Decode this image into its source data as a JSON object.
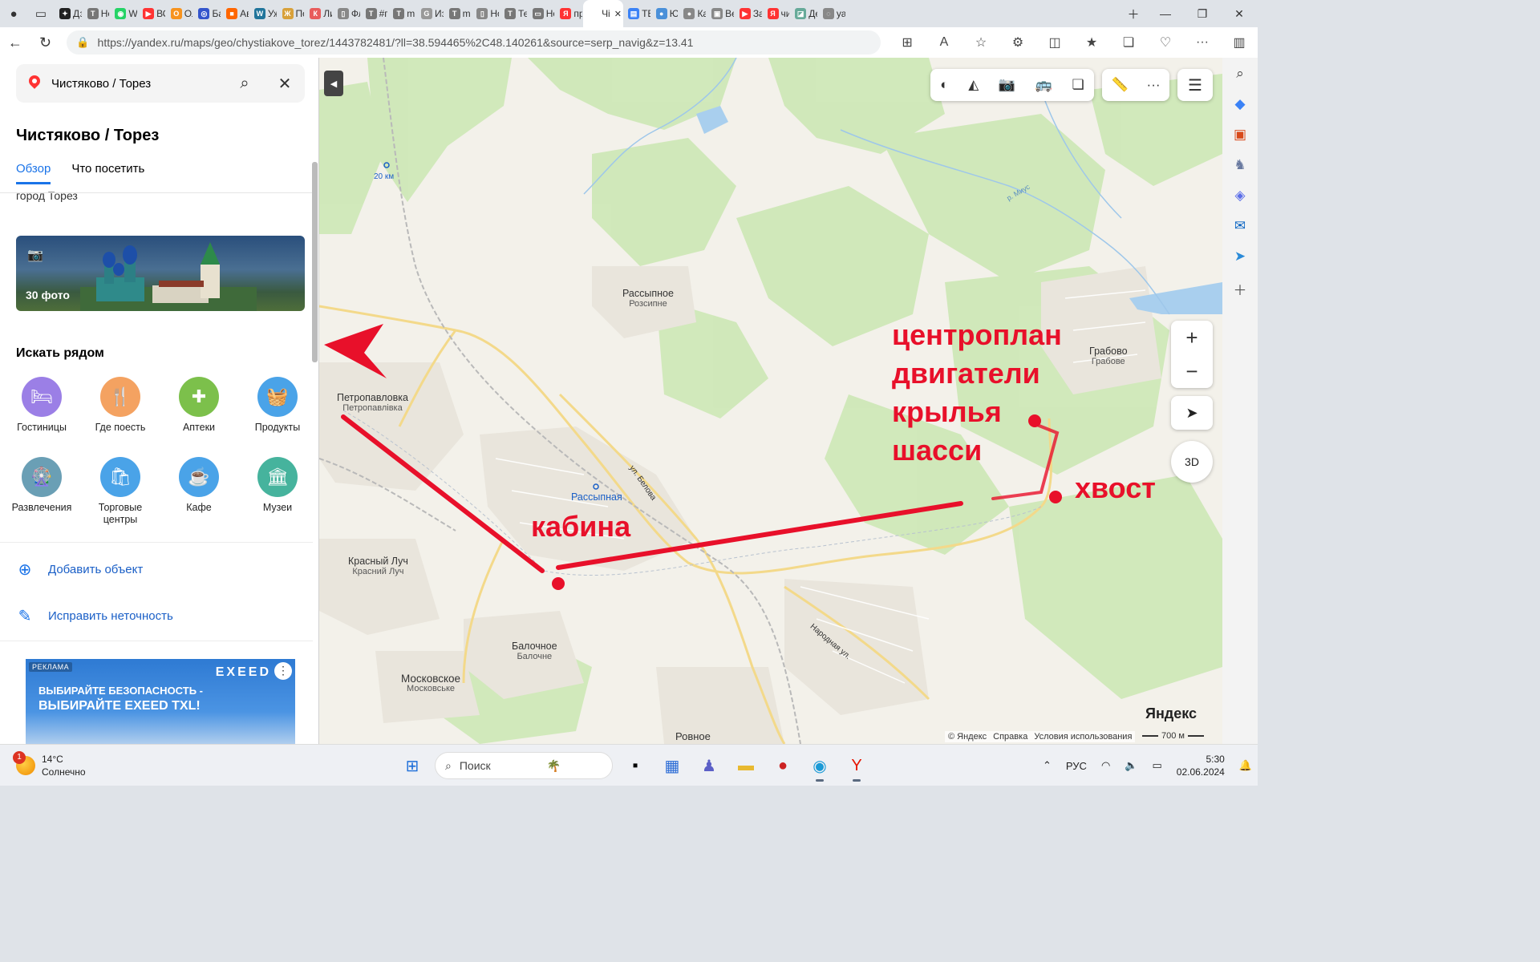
{
  "browser": {
    "tabs": [
      {
        "label": "Дз",
        "color": "#222",
        "glyph": "✦"
      },
      {
        "label": "Не",
        "color": "#777",
        "glyph": "T"
      },
      {
        "label": "W",
        "color": "#25d366",
        "glyph": "◉"
      },
      {
        "label": "ВС",
        "color": "#ff3333",
        "glyph": "▶"
      },
      {
        "label": "Ол",
        "color": "#f7931e",
        "glyph": "О"
      },
      {
        "label": "Ба",
        "color": "#3355cc",
        "glyph": "◎"
      },
      {
        "label": "Ав",
        "color": "#ff6600",
        "glyph": "■"
      },
      {
        "label": "Уж",
        "color": "#21759b",
        "glyph": "W"
      },
      {
        "label": "По",
        "color": "#d8a13a",
        "glyph": "Ж"
      },
      {
        "label": "Ли",
        "color": "#e85c5c",
        "glyph": "К"
      },
      {
        "label": "Фл",
        "color": "#888",
        "glyph": "▯"
      },
      {
        "label": "#п",
        "color": "#777",
        "glyph": "T"
      },
      {
        "label": "m",
        "color": "#777",
        "glyph": "T"
      },
      {
        "label": "Из",
        "color": "#999",
        "glyph": "G"
      },
      {
        "label": "m",
        "color": "#777",
        "glyph": "T"
      },
      {
        "label": "Но",
        "color": "#888",
        "glyph": "▯"
      },
      {
        "label": "Те",
        "color": "#777",
        "glyph": "T"
      },
      {
        "label": "Но",
        "color": "#777",
        "glyph": "▭"
      },
      {
        "label": "пр",
        "color": "#ff3333",
        "glyph": "Я"
      },
      {
        "label": "Чі",
        "color": "#fff",
        "glyph": ""
      },
      {
        "label": "ТЕ",
        "color": "#3b82f6",
        "glyph": "▤"
      },
      {
        "label": "Ю",
        "color": "#4a90d9",
        "glyph": "●"
      },
      {
        "label": "Ка",
        "color": "#888",
        "glyph": "●"
      },
      {
        "label": "Ве",
        "color": "#888",
        "glyph": "▣"
      },
      {
        "label": "За",
        "color": "#ff3333",
        "glyph": "▶"
      },
      {
        "label": "чи",
        "color": "#ff3333",
        "glyph": "Я"
      },
      {
        "label": "Де",
        "color": "#6a9",
        "glyph": "◪"
      },
      {
        "label": "уа",
        "color": "#888",
        "glyph": "◌"
      }
    ],
    "url": "https://yandex.ru/maps/geo/chystiakove_torez/1443782481/?ll=38.594465%2C48.140261&source=serp_navig&z=13.41"
  },
  "panel": {
    "search_value": "Чистяково / Торез",
    "title": "Чистяково / Торез",
    "tab_overview": "Обзор",
    "tab_visit": "Что посетить",
    "clipped_text": "город Торез",
    "photo_count": "30 фото",
    "nearby_title": "Искать рядом",
    "categories": [
      {
        "label": "Гостиницы",
        "color": "#9b7fe6",
        "icon": "🛏"
      },
      {
        "label": "Где поесть",
        "color": "#f4a261",
        "icon": "🍴"
      },
      {
        "label": "Аптеки",
        "color": "#7cc04b",
        "icon": "✚"
      },
      {
        "label": "Продукты",
        "color": "#4aa3e8",
        "icon": "🧺"
      },
      {
        "label": "Развлечения",
        "color": "#6a9fb5",
        "icon": "🎡"
      },
      {
        "label": "Торговые центры",
        "color": "#4aa3e8",
        "icon": "🛍"
      },
      {
        "label": "Кафе",
        "color": "#4aa3e8",
        "icon": "☕"
      },
      {
        "label": "Музеи",
        "color": "#46b39d",
        "icon": "🏛"
      }
    ],
    "add_object": "Добавить объект",
    "fix_error": "Исправить неточность",
    "ad": {
      "tag": "РЕКЛАМА",
      "brand": "EXEED",
      "line1": "ВЫБИРАЙТЕ БЕЗОПАСНОСТЬ -",
      "line2": "ВЫБИРАЙТЕ EXEED TXL!"
    }
  },
  "map": {
    "places": [
      {
        "name": "Петропавловка",
        "sub": "Петропавлівка"
      },
      {
        "name": "Рассыпное",
        "sub": "Розсипне"
      },
      {
        "name": "Грабово",
        "sub": "Грабове"
      },
      {
        "name": "Рассыпная",
        "sub": ""
      },
      {
        "name": "Красный Луч",
        "sub": "Красний Луч"
      },
      {
        "name": "Балочное",
        "sub": "Балочне"
      },
      {
        "name": "Московское",
        "sub": "Московське"
      },
      {
        "name": "Ровное",
        "sub": ""
      }
    ],
    "streets": [
      "ул. Белова",
      "Народная ул.",
      "р. Миус"
    ],
    "km_marker": "20 км",
    "annotations": {
      "cabin": "кабина",
      "tail": "хвост",
      "line1": "центроплан",
      "line2": "двигатели",
      "line3": "крылья",
      "line4": "шасси"
    },
    "btn_3d": "3D",
    "logo": "Яндекс",
    "copyright": "© Яндекс",
    "help": "Справка",
    "terms": "Условия использования",
    "scale": "700 м",
    "annotation_color": "#e8102a"
  },
  "taskbar": {
    "temp": "14°C",
    "weather": "Солнечно",
    "badge": "1",
    "search_placeholder": "Поиск",
    "lang": "РУС",
    "time": "5:30",
    "date": "02.06.2024"
  }
}
